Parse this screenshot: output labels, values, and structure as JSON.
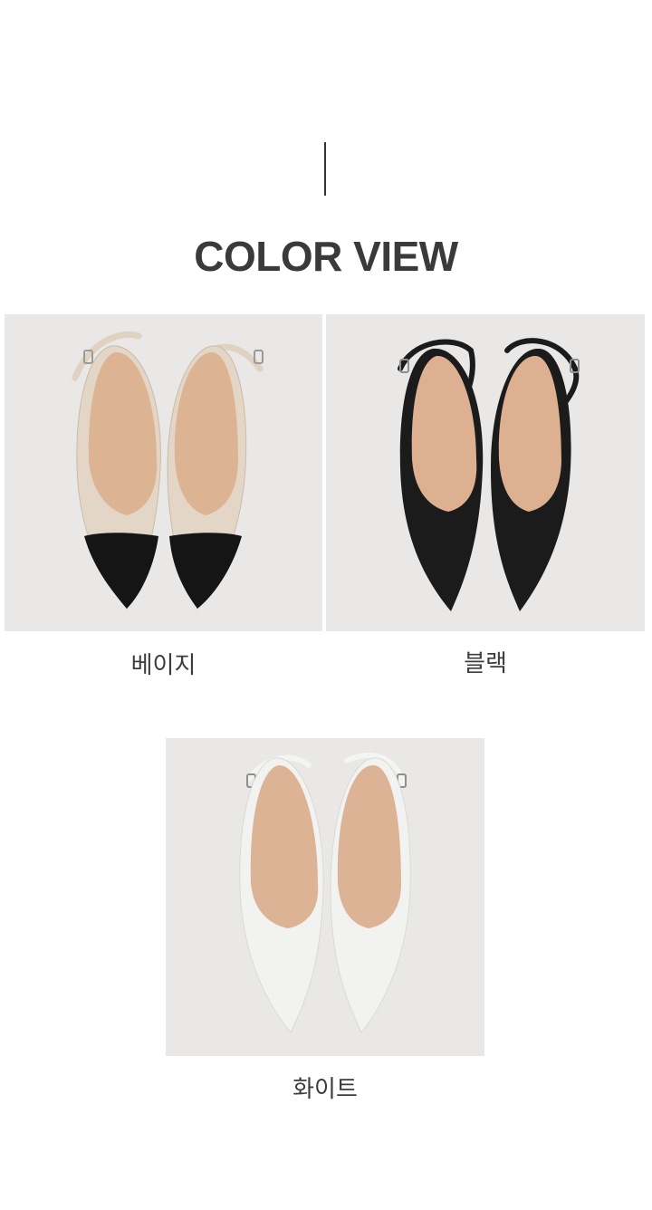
{
  "section": {
    "title": "COLOR VIEW"
  },
  "products": [
    {
      "label": "베이지",
      "image_icon": "beige-slingback-shoes-photo",
      "colors": {
        "body": "#e3d6c6",
        "toe": "#151516",
        "lining": "#ddb493"
      }
    },
    {
      "label": "블랙",
      "image_icon": "black-slingback-shoes-photo",
      "colors": {
        "body": "#1b1b1c",
        "toe": "#161617",
        "lining": "#dcb091"
      }
    },
    {
      "label": "화이트",
      "image_icon": "white-slingback-shoes-photo",
      "colors": {
        "body": "#f2f2f1",
        "toe": "#eeeeee",
        "lining": "#dcb394"
      }
    }
  ]
}
